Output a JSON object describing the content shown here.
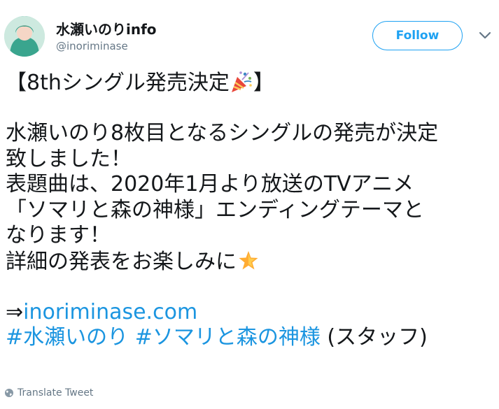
{
  "header": {
    "display_name": "水瀬いのりinfo",
    "handle": "@inoriminase",
    "follow_label": "Follow"
  },
  "tweet": {
    "heading_open": "【8thシングル発売決定",
    "heading_close": "】",
    "line1": "水瀬いのり8枚目となるシングルの発売が決定",
    "line2": "致しました！",
    "line3": "表題曲は、2020年1月より放送のTVアニメ",
    "line4": "「ソマリと森の神様」エンディングテーマと",
    "line5": "なります！",
    "line6": "詳細の発表をお楽しみに",
    "arrow": "⇒",
    "link": "inoriminase.com",
    "hashtag1": "#水瀬いのり",
    "hashtag2": "#ソマリと森の神様",
    "staff_note": " (スタッフ)"
  },
  "footer": {
    "translate_label": "Translate Tweet"
  },
  "icons": {
    "party_popper": "party-popper-icon",
    "star": "glowing-star-icon",
    "globe": "globe-icon",
    "chevron": "chevron-down-icon"
  },
  "colors": {
    "link_blue": "#1b95e0",
    "follow_blue": "#1da1f2",
    "secondary_gray": "#657786"
  }
}
